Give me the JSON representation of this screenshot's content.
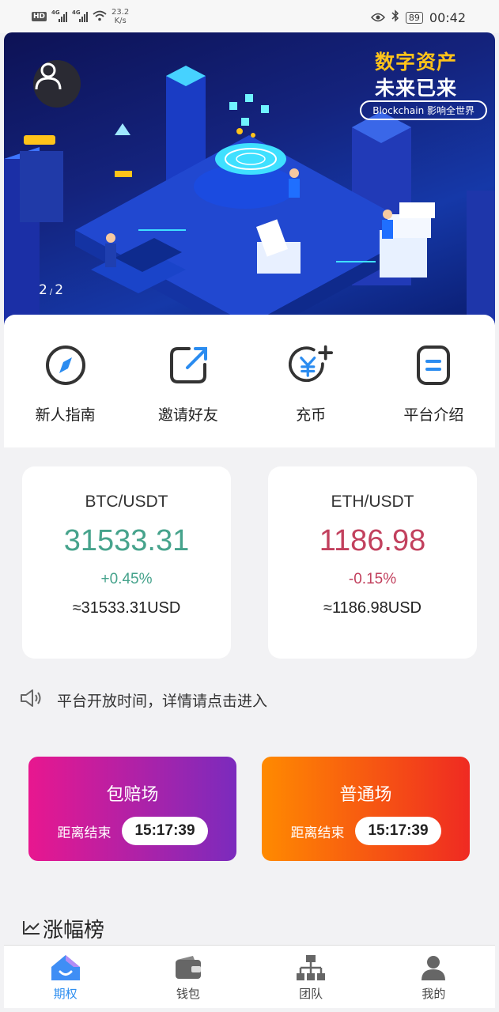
{
  "status_bar": {
    "hd": "HD",
    "net1": "4G",
    "net2": "4G",
    "speed_value": "23.2",
    "speed_unit": "K/s",
    "battery": "89",
    "time": "00:42"
  },
  "banner": {
    "title_line1": "数字资产",
    "title_line2": "未来已来",
    "tagline": "Blockchain 影响全世界",
    "page_current": "2",
    "page_total": "2"
  },
  "menu": [
    {
      "label": "新人指南",
      "icon": "compass-icon"
    },
    {
      "label": "邀请好友",
      "icon": "share-icon"
    },
    {
      "label": "充币",
      "icon": "yuan-add-icon"
    },
    {
      "label": "平台介绍",
      "icon": "info-card-icon"
    }
  ],
  "tickers": [
    {
      "pair": "BTC/USDT",
      "price": "31533.31",
      "change": "+0.45%",
      "usd": "≈31533.31USD",
      "trend": "up"
    },
    {
      "pair": "ETH/USDT",
      "price": "1186.98",
      "change": "-0.15%",
      "usd": "≈1186.98USD",
      "trend": "down"
    }
  ],
  "notice": {
    "text": "平台开放时间，详情请点击进入"
  },
  "sessions": [
    {
      "title": "包赔场",
      "countdown_label": "距离结束",
      "countdown": "15:17:39"
    },
    {
      "title": "普通场",
      "countdown_label": "距离结束",
      "countdown": "15:17:39"
    }
  ],
  "ranking": {
    "title": "涨幅榜"
  },
  "tabs": [
    {
      "label": "期权",
      "active": true
    },
    {
      "label": "钱包",
      "active": false
    },
    {
      "label": "团队",
      "active": false
    },
    {
      "label": "我的",
      "active": false
    }
  ],
  "colors": {
    "up": "#46a38c",
    "down": "#c2415e",
    "tab_active": "#2f8ff0",
    "session1_gradient": [
      "#e8178f",
      "#7b2bbd"
    ],
    "session2_gradient": [
      "#ff8a00",
      "#ef2a22"
    ]
  }
}
